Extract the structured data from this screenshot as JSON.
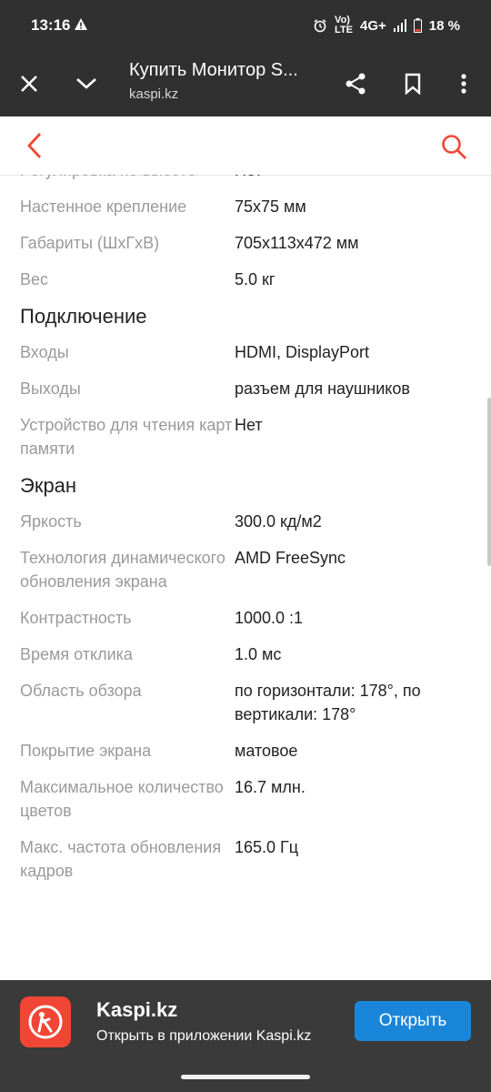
{
  "status_bar": {
    "time": "13:16",
    "network_top": "Vo)",
    "network_bottom": "LTE",
    "signal": "4G+",
    "battery": "18 %"
  },
  "browser": {
    "title": "Купить Монитор S...",
    "domain": "kaspi.kz"
  },
  "specs": {
    "partial_row": {
      "label": "Регулировка по высоте",
      "value": "Нет"
    },
    "rows_a": [
      {
        "label": "Настенное крепление",
        "value": "75х75 мм"
      },
      {
        "label": "Габариты (ШхГхВ)",
        "value": "705x113x472 мм"
      },
      {
        "label": "Вес",
        "value": "5.0 кг"
      }
    ],
    "section_connection": "Подключение",
    "rows_b": [
      {
        "label": "Входы",
        "value": "HDMI, DisplayPort"
      },
      {
        "label": "Выходы",
        "value": "разъем для наушников"
      },
      {
        "label": "Устройство для чтения карт памяти",
        "value": "Нет"
      }
    ],
    "section_screen": "Экран",
    "rows_c": [
      {
        "label": "Яркость",
        "value": "300.0 кд/м2"
      },
      {
        "label": "Технология динамического обновления экрана",
        "value": "AMD FreeSync"
      },
      {
        "label": "Контрастность",
        "value": "1000.0 :1"
      },
      {
        "label": "Время отклика",
        "value": "1.0 мс"
      },
      {
        "label": "Область обзора",
        "value": "по горизонтали: 178°, по вертикали: 178°"
      },
      {
        "label": "Покрытие экрана",
        "value": "матовое"
      },
      {
        "label": "Максимальное количество цветов",
        "value": "16.7 млн."
      },
      {
        "label": "Макс. частота обновления кадров",
        "value": "165.0 Гц"
      }
    ]
  },
  "app_banner": {
    "name": "Kaspi.kz",
    "subtitle": "Открыть в приложении Kaspi.kz",
    "open_label": "Открыть"
  },
  "colors": {
    "accent_red": "#f14635",
    "button_blue": "#1a86d9",
    "toolbar_dark": "#303030"
  }
}
